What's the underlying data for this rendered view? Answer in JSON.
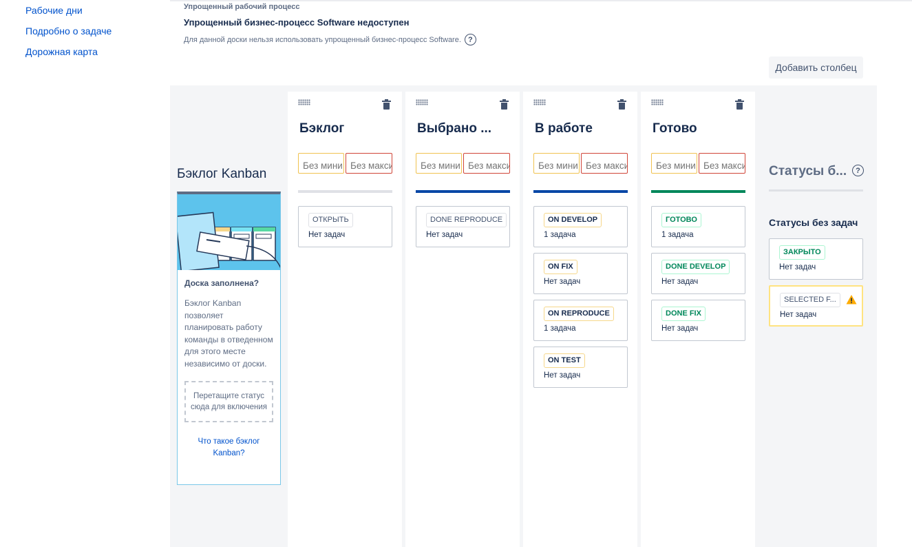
{
  "sidebar": {
    "items": [
      {
        "label": "Рабочие дни"
      },
      {
        "label": "Подробно о задаче"
      },
      {
        "label": "Дорожная карта"
      }
    ]
  },
  "workflow": {
    "label": "Упрощенный рабочий процесс",
    "title": "Упрощенный бизнес-процесс Software недоступен",
    "description": "Для данной доски нельзя использовать упрощенный бизнес-процесс Software.",
    "help_icon": "question-circle-icon"
  },
  "toolbar": {
    "add_column_label": "Добавить столбец"
  },
  "backlog": {
    "title": "Бэклог Kanban",
    "question": "Доска заполнена?",
    "text": "Бэклог Kanban позволяет планировать работу команды в отведенном для этого месте независимо от доски.",
    "dropzone": "Перетащите статус сюда для включения",
    "link": "Что такое бэклог Kanban?"
  },
  "limits": {
    "min_placeholder": "Без мини",
    "max_placeholder": "Без макси"
  },
  "columns": [
    {
      "title": "Бэклог",
      "bar_color": "#dfe1e6",
      "statuses": [
        {
          "label": "ОТКРЫТЬ",
          "count": "Нет задач",
          "color": "grey"
        }
      ]
    },
    {
      "title": "Выбрано ...",
      "bar_color": "#0747a6",
      "statuses": [
        {
          "label": "DONE REPRODUCE",
          "count": "Нет задач",
          "color": "grey"
        }
      ]
    },
    {
      "title": "В работе",
      "bar_color": "#0747a6",
      "statuses": [
        {
          "label": "ON DEVELOP",
          "count": "1 задача",
          "color": "yellow"
        },
        {
          "label": "ON FIX",
          "count": "Нет задач",
          "color": "yellow"
        },
        {
          "label": "ON REPRODUCE",
          "count": "1 задача",
          "color": "yellow"
        },
        {
          "label": "ON TEST",
          "count": "Нет задач",
          "color": "yellow"
        }
      ]
    },
    {
      "title": "Готово",
      "bar_color": "#00875a",
      "statuses": [
        {
          "label": "ГОТОВО",
          "count": "1 задача",
          "color": "green"
        },
        {
          "label": "DONE DEVELOP",
          "count": "Нет задач",
          "color": "green"
        },
        {
          "label": "DONE FIX",
          "count": "Нет задач",
          "color": "green"
        }
      ]
    }
  ],
  "unmapped": {
    "title": "Статусы б...",
    "subtitle": "Статусы без задач",
    "statuses": [
      {
        "label": "ЗАКРЫТО",
        "count": "Нет задач",
        "color": "green"
      },
      {
        "label": "SELECTED F...",
        "count": "Нет задач",
        "color": "grey",
        "warning": true
      }
    ]
  }
}
